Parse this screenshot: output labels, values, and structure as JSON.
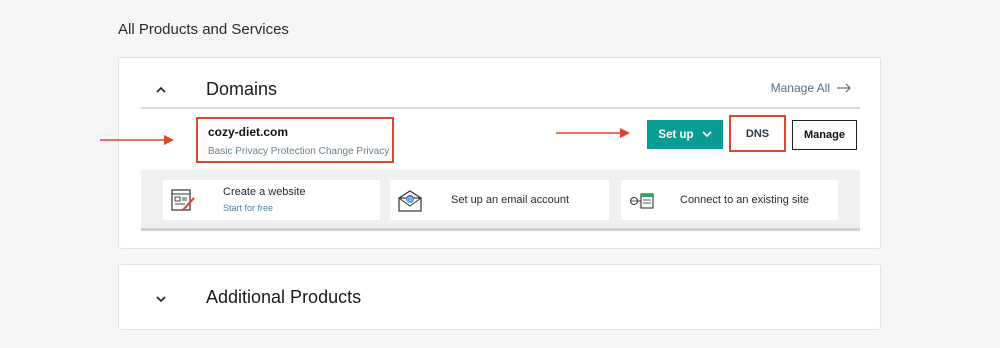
{
  "page": {
    "heading": "All Products and Services"
  },
  "domains": {
    "title": "Domains",
    "manage_all": "Manage All",
    "domain": {
      "name": "cozy-diet.com",
      "privacy": "Basic Privacy Protection",
      "change_privacy": "Change Privacy"
    },
    "actions": {
      "setup": "Set up",
      "dns": "DNS",
      "manage": "Manage"
    },
    "quick_actions": [
      {
        "title": "Create a website",
        "subtitle": "Start for free",
        "icon": "website-builder-icon"
      },
      {
        "title": "Set up an email account",
        "icon": "email-envelope-icon"
      },
      {
        "title": "Connect to an existing site",
        "icon": "connect-site-icon"
      }
    ]
  },
  "additional": {
    "title": "Additional Products"
  },
  "colors": {
    "accent_teal": "#0a9c92",
    "annotation_red": "#e0452d",
    "link_blue": "#4f7fa0"
  }
}
